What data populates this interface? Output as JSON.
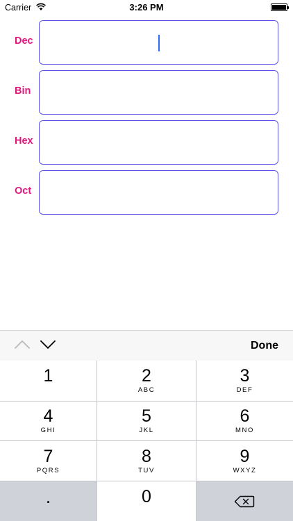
{
  "status_bar": {
    "carrier": "Carrier",
    "time": "3:26 PM"
  },
  "fields": [
    {
      "label": "Dec",
      "value": ""
    },
    {
      "label": "Bin",
      "value": ""
    },
    {
      "label": "Hex",
      "value": ""
    },
    {
      "label": "Oct",
      "value": ""
    }
  ],
  "toolbar": {
    "previous_icon": "chevron-up-icon",
    "next_icon": "chevron-down-icon",
    "done_label": "Done"
  },
  "keypad": {
    "keys": [
      {
        "digit": "1",
        "letters": ""
      },
      {
        "digit": "2",
        "letters": "ABC"
      },
      {
        "digit": "3",
        "letters": "DEF"
      },
      {
        "digit": "4",
        "letters": "GHI"
      },
      {
        "digit": "5",
        "letters": "JKL"
      },
      {
        "digit": "6",
        "letters": "MNO"
      },
      {
        "digit": "7",
        "letters": "PQRS"
      },
      {
        "digit": "8",
        "letters": "TUV"
      },
      {
        "digit": "9",
        "letters": "WXYZ"
      }
    ],
    "decimal": ".",
    "zero": "0",
    "delete_icon": "delete-backspace-icon"
  },
  "colors": {
    "label": "#e0177f",
    "field_border": "#5a55e6",
    "caret": "#2c6bf0",
    "keypad_dark": "#cfd3d9"
  }
}
